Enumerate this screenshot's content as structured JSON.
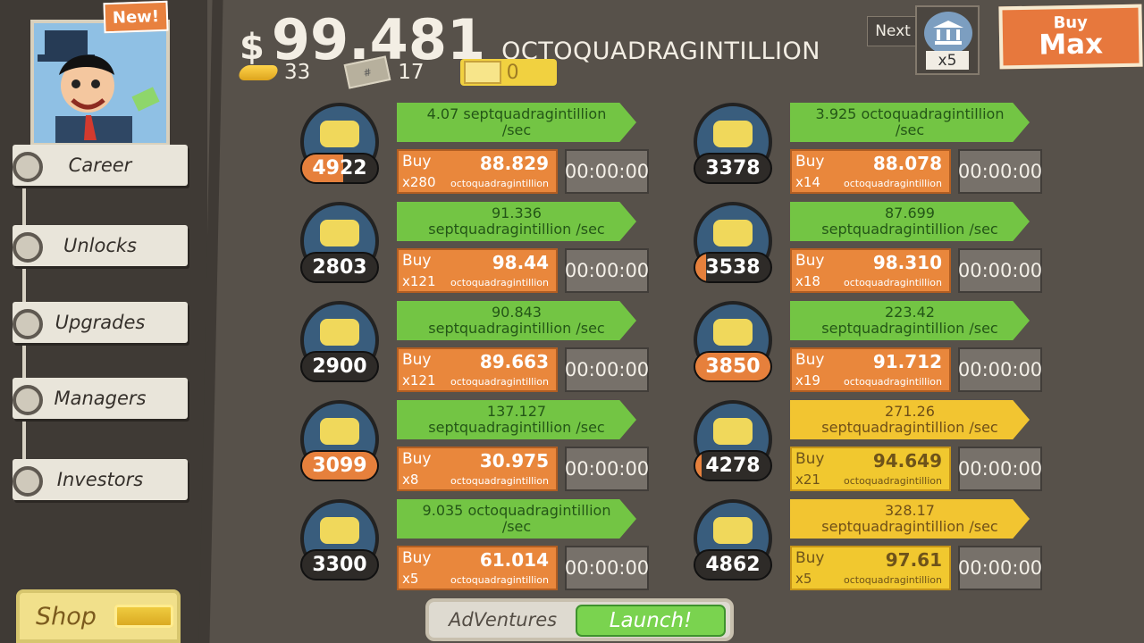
{
  "header": {
    "badge": "New!",
    "currency_symbol": "$",
    "money_amount": "99.481",
    "money_unit": "OCTOQUADRAGINTILLION",
    "gold": "33",
    "tickets": "17",
    "megabucks": "0",
    "next_label": "Next",
    "next_count": "x5",
    "buy_max_top": "Buy",
    "buy_max_bottom": "Max"
  },
  "sidebar": {
    "items": [
      {
        "label": "Career"
      },
      {
        "label": "Unlocks"
      },
      {
        "label": "Upgrades"
      },
      {
        "label": "Managers"
      },
      {
        "label": "Investors"
      }
    ],
    "shop": "Shop"
  },
  "businesses": [
    {
      "icon": "lemon-icon",
      "owned": "4922",
      "progress": 0.55,
      "rate": "4.07 septquadragintillion /sec",
      "buy": "Buy",
      "mult": "x280",
      "cost": "88.829",
      "cost_unit": "octoquadragintillion",
      "timer": "00:00:00",
      "style": "green"
    },
    {
      "icon": "newspaper-icon",
      "owned": "2803",
      "progress": 0,
      "rate": "91.336 septquadragintillion /sec",
      "buy": "Buy",
      "mult": "x121",
      "cost": "98.44",
      "cost_unit": "octoquadragintillion",
      "timer": "00:00:00",
      "style": "green"
    },
    {
      "icon": "car-icon",
      "owned": "2900",
      "progress": 0,
      "rate": "90.843 septquadragintillion /sec",
      "buy": "Buy",
      "mult": "x121",
      "cost": "89.663",
      "cost_unit": "octoquadragintillion",
      "timer": "00:00:00",
      "style": "green"
    },
    {
      "icon": "pizza-icon",
      "owned": "3099",
      "progress": 1,
      "rate": "137.127 septquadragintillion /sec",
      "buy": "Buy",
      "mult": "x8",
      "cost": "30.975",
      "cost_unit": "octoquadragintillion",
      "timer": "00:00:00",
      "style": "green"
    },
    {
      "icon": "donut-icon",
      "owned": "3300",
      "progress": 0,
      "rate": "9.035 octoquadragintillion /sec",
      "buy": "Buy",
      "mult": "x5",
      "cost": "61.014",
      "cost_unit": "octoquadragintillion",
      "timer": "00:00:00",
      "style": "green"
    },
    {
      "icon": "shrimp-icon",
      "owned": "3378",
      "progress": 0,
      "rate": "3.925 octoquadragintillion /sec",
      "buy": "Buy",
      "mult": "x14",
      "cost": "88.078",
      "cost_unit": "octoquadragintillion",
      "timer": "00:00:00",
      "style": "green"
    },
    {
      "icon": "hockey-icon",
      "owned": "3538",
      "progress": 0.14,
      "rate": "87.699 septquadragintillion /sec",
      "buy": "Buy",
      "mult": "x18",
      "cost": "98.310",
      "cost_unit": "octoquadragintillion",
      "timer": "00:00:00",
      "style": "green"
    },
    {
      "icon": "movie-icon",
      "owned": "3850",
      "progress": 1,
      "rate": "223.42 septquadragintillion /sec",
      "buy": "Buy",
      "mult": "x19",
      "cost": "91.712",
      "cost_unit": "octoquadragintillion",
      "timer": "00:00:00",
      "style": "green"
    },
    {
      "icon": "bank-icon",
      "owned": "4278",
      "progress": 0.08,
      "rate": "271.26 septquadragintillion /sec",
      "buy": "Buy",
      "mult": "x21",
      "cost": "94.649",
      "cost_unit": "octoquadragintillion",
      "timer": "00:00:00",
      "style": "gold"
    },
    {
      "icon": "oil-icon",
      "owned": "4862",
      "progress": 0,
      "rate": "328.17 septquadragintillion /sec",
      "buy": "Buy",
      "mult": "x5",
      "cost": "97.61",
      "cost_unit": "octoquadragintillion",
      "timer": "00:00:00",
      "style": "gold"
    }
  ],
  "adventures": {
    "label": "AdVentures",
    "launch": "Launch!"
  },
  "colors": {
    "background": "#57514a",
    "green": "#73c544",
    "orange": "#e9873c",
    "gold": "#f1c82f"
  }
}
